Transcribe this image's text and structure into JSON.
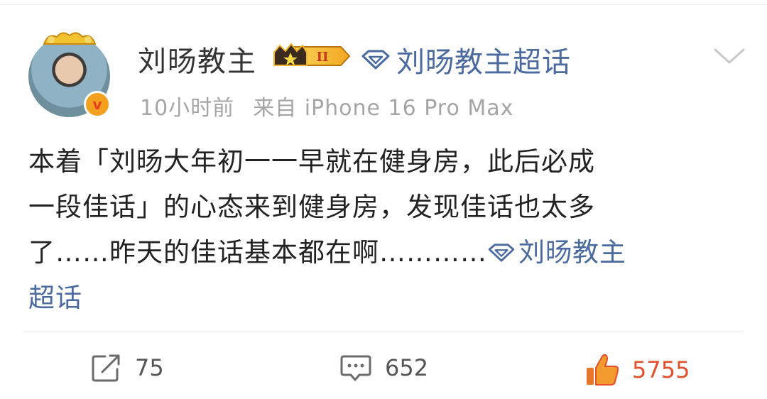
{
  "post": {
    "author": "刘旸教主",
    "fan_badge_level": "II",
    "supertopic_link": "刘旸教主超话",
    "time": "10小时前",
    "source": "来自 iPhone 16 Pro Max",
    "text_line1": "本着「刘旸大年初一一早就在健身房，此后必成",
    "text_line2": "一段佳话」的心态来到健身房，发现佳话也太多",
    "text_line3": "了……昨天的佳话基本都在啊…………",
    "topic_tail_1": "刘旸教主",
    "topic_tail_2": "超话"
  },
  "actions": {
    "repost_count": "75",
    "comment_count": "652",
    "like_count": "5755"
  },
  "colors": {
    "link": "#4a6aa0",
    "like": "#e2502c",
    "meta": "#a5a5a5"
  },
  "icons": {
    "avatar_badge": "verified-v-badge",
    "fan_badge": "crown-badge",
    "topic": "diamond-icon",
    "more": "chevron-down-icon",
    "repost": "repost-icon",
    "comment": "comment-icon",
    "like": "thumbs-up-icon"
  }
}
